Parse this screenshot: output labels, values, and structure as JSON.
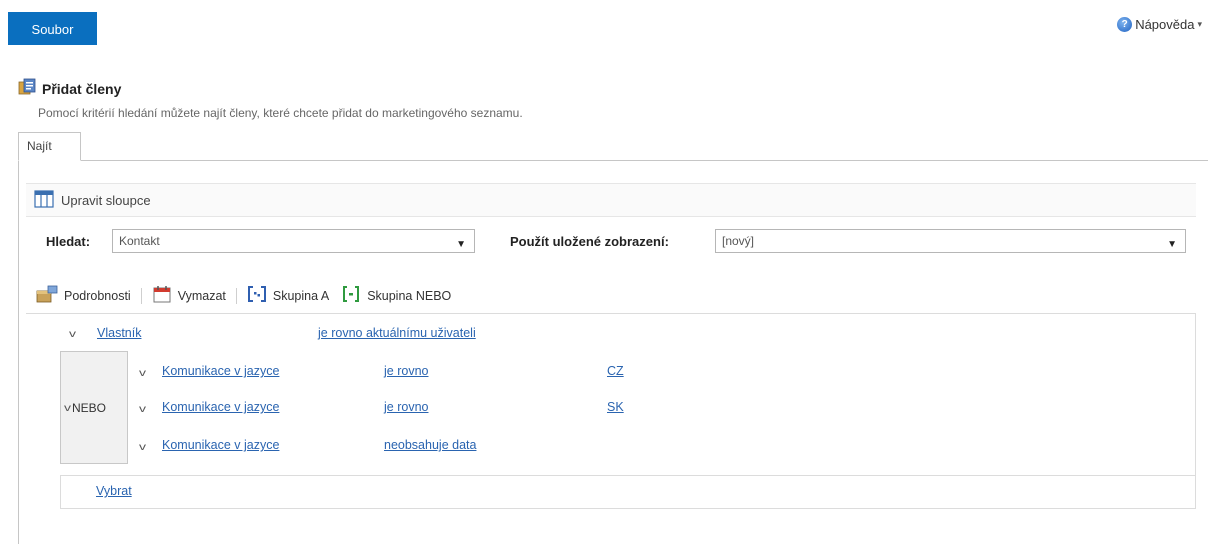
{
  "header": {
    "file_button": "Soubor",
    "help_label": "Nápověda",
    "help_icon": "help-globe-icon",
    "help_caret": "▾"
  },
  "dialog": {
    "title": "Přidat členy",
    "title_icon": "add-members-icon",
    "description": "Pomocí kritérií hledání můžete najít členy, které chcete přidat do marketingového seznamu."
  },
  "tabs": [
    {
      "label": "Najít"
    }
  ],
  "edit_columns": {
    "label": "Upravit sloupce",
    "icon": "edit-columns-icon"
  },
  "search": {
    "look_for_label": "Hledat:",
    "look_for_value": "Kontakt",
    "saved_view_label": "Použít uložené zobrazení:",
    "saved_view_value": "[nový]"
  },
  "toolbar": {
    "details": "Podrobnosti",
    "delete": "Vymazat",
    "group_and": "Skupina A",
    "group_or": "Skupina NEBO"
  },
  "conditions": {
    "owner": {
      "field": "Vlastník",
      "operator": "je rovno aktuálnímu uživateli"
    },
    "group": {
      "label": "NEBO",
      "rows": [
        {
          "field": "Komunikace v jazyce",
          "operator": "je rovno",
          "value": "CZ"
        },
        {
          "field": "Komunikace v jazyce",
          "operator": "je rovno",
          "value": "SK"
        },
        {
          "field": "Komunikace v jazyce",
          "operator": "neobsahuje data",
          "value": ""
        }
      ]
    },
    "select_link": "Vybrat"
  },
  "colors": {
    "accent": "#0a6fbf",
    "link": "#2a64b0"
  }
}
